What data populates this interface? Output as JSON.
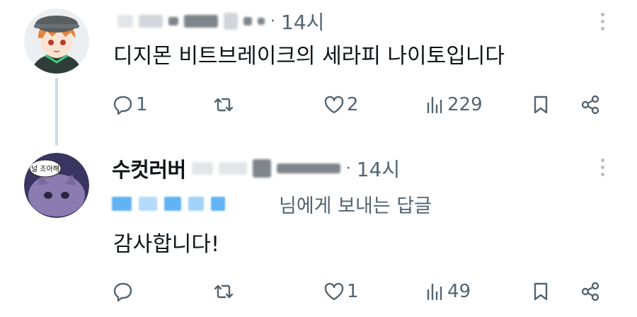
{
  "tweets": [
    {
      "display_name": "",
      "time": "14시",
      "text": "디지몬 비트브레이크의 세라피 나이토입니다",
      "reply_to_suffix": "",
      "stats": {
        "replies": "1",
        "retweets": "",
        "likes": "2",
        "views": "229"
      }
    },
    {
      "display_name": "수컷러버",
      "avatar_text": "널 조아해",
      "time": "14시",
      "reply_to_suffix": "님에게 보내는 답글",
      "text": "감사합니다!",
      "stats": {
        "replies": "",
        "retweets": "",
        "likes": "1",
        "views": "49"
      }
    }
  ],
  "icons": {
    "reply": "reply-icon",
    "retweet": "retweet-icon",
    "like": "heart-icon",
    "views": "views-icon",
    "bookmark": "bookmark-icon",
    "share": "share-icon",
    "more": "more-icon"
  },
  "colors": {
    "text": "#0f1419",
    "muted": "#536471",
    "thread": "#cfd9de",
    "link_blur": "#47a6f1"
  }
}
